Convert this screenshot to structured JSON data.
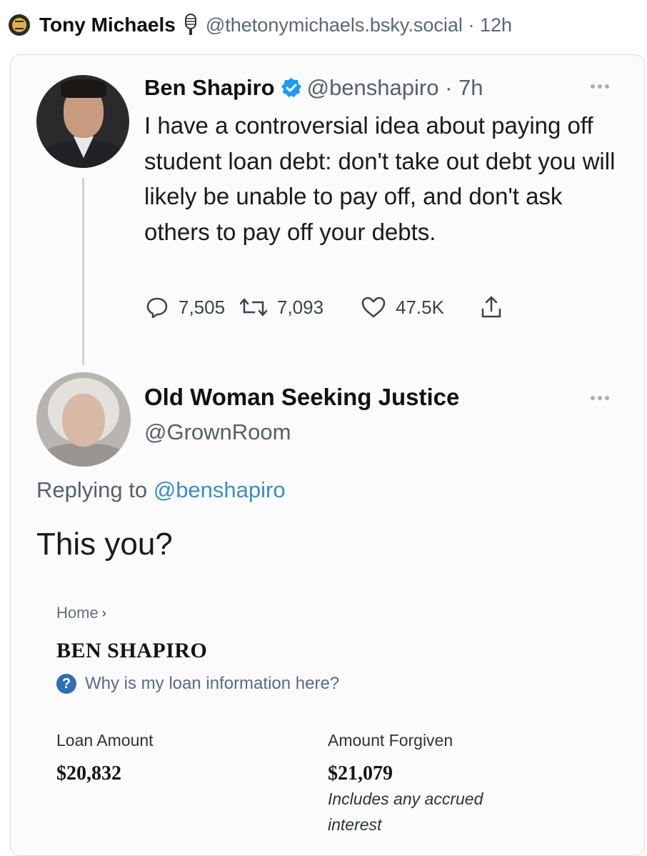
{
  "post": {
    "author_name": "Tony Michaels",
    "author_handle": "@thetonymichaels.bsky.social",
    "separator": "·",
    "age": "12h"
  },
  "embedded_tweet": {
    "name": "Ben Shapiro",
    "handle": "@benshapiro",
    "separator": "·",
    "age": "7h",
    "text": "I have a controversial idea about paying off student loan debt: don't take out debt you will likely be unable to pay off, and don't ask others to pay off your debts.",
    "replies": "7,505",
    "retweets": "7,093",
    "likes": "47.5K"
  },
  "reply_tweet": {
    "name": "Old Woman Seeking Justice",
    "handle": "@GrownRoom",
    "replying_prefix": "Replying to",
    "replying_to": "@benshapiro",
    "text": "This you?"
  },
  "loan_screenshot": {
    "breadcrumb": "Home",
    "breadcrumb_chevron": "›",
    "name": "BEN SHAPIRO",
    "help_glyph": "?",
    "help_text": "Why is my loan information here?",
    "loan_amount_label": "Loan Amount",
    "loan_amount_value": "$20,832",
    "forgiven_label": "Amount Forgiven",
    "forgiven_value": "$21,079",
    "forgiven_note": "Includes any accrued",
    "forgiven_note_cut": "interest"
  },
  "colors": {
    "link": "#3a8ec4",
    "verified": "#1d9bf0",
    "help_badge": "#2e6fb8"
  }
}
